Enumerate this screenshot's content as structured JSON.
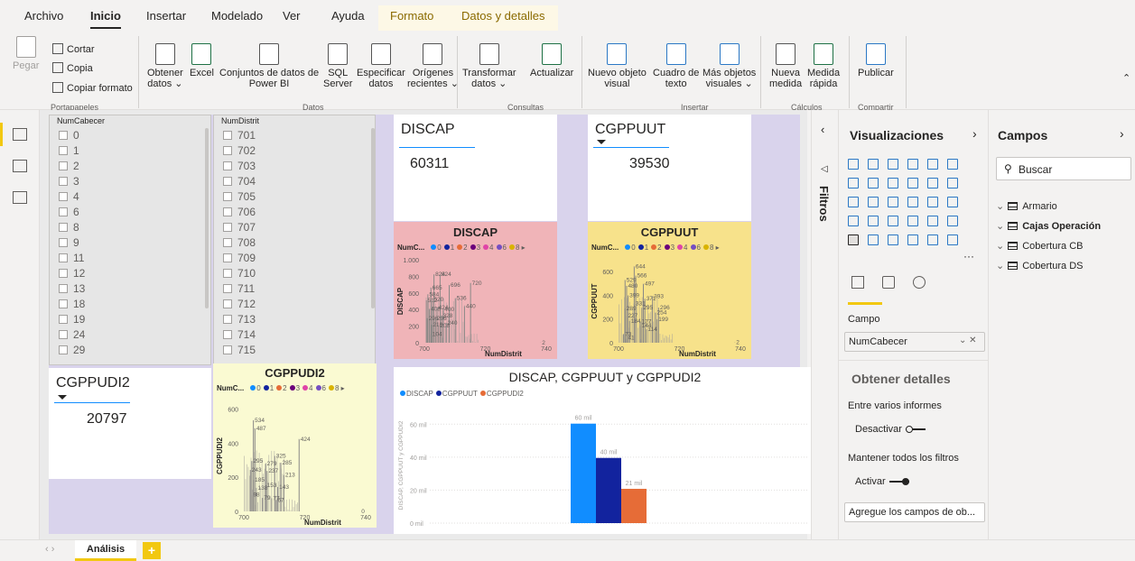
{
  "menu": {
    "tabs": [
      "Archivo",
      "Inicio",
      "Insertar",
      "Modelado",
      "Ver",
      "Ayuda",
      "Formato",
      "Datos y detalles"
    ],
    "active": "Inicio"
  },
  "ribbon": {
    "paste": "Pegar",
    "cut": "Cortar",
    "copy": "Copia",
    "copy_format": "Copiar formato",
    "g_clipboard": "Portapapeles",
    "get_data": "Obtener\ndatos ⌄",
    "excel": "Excel",
    "datasets": "Conjuntos de datos de\nPower BI",
    "sql": "SQL\nServer",
    "enter_data": "Especificar\ndatos",
    "recent": "Orígenes\nrecientes ⌄",
    "g_data": "Datos",
    "transform": "Transformar\ndatos ⌄",
    "refresh": "Actualizar",
    "g_queries": "Consultas",
    "new_visual": "Nuevo objeto\nvisual",
    "textbox": "Cuadro de\ntexto",
    "more_visuals": "Más objetos\nvisuales ⌄",
    "g_insert": "Insertar",
    "new_measure": "Nueva\nmedida",
    "quick_measure": "Medida\nrápida",
    "g_calc": "Cálculos",
    "publish": "Publicar",
    "g_share": "Compartir"
  },
  "slicer1": {
    "title": "NumCabecer",
    "items": [
      "0",
      "1",
      "2",
      "3",
      "4",
      "6",
      "8",
      "9",
      "11",
      "12",
      "13",
      "18",
      "19",
      "24",
      "29"
    ]
  },
  "slicer2": {
    "title": "NumDistrit",
    "items": [
      "701",
      "702",
      "703",
      "704",
      "705",
      "706",
      "707",
      "708",
      "709",
      "710",
      "711",
      "712",
      "713",
      "714",
      "715"
    ]
  },
  "cards": [
    {
      "title": "DISCAP",
      "value": "60311"
    },
    {
      "title": "CGPPUUT",
      "value": "39530"
    },
    {
      "title": "CGPPUDI2",
      "value": "20797"
    }
  ],
  "colors": {
    "discap": "#118dff",
    "cgppuut": "#12239e",
    "cgppudi2": "#e66c37",
    "pink": "#f0b4b8",
    "yellow": "#f7e28b",
    "lightyellow": "#fafad2",
    "accent": "#f2c811"
  },
  "legend": {
    "field": "NumC...",
    "entries": [
      "0",
      "1",
      "2",
      "3",
      "4",
      "6",
      "8"
    ],
    "colors": [
      "#118dff",
      "#12239e",
      "#e66c37",
      "#6b007b",
      "#e044a7",
      "#744ec2",
      "#d9b300"
    ]
  },
  "chart_data": [
    {
      "type": "bar",
      "title": "DISCAP",
      "xlabel": "NumDistrit",
      "ylabel": "DISCAP",
      "ylim": [
        0,
        1000
      ],
      "xlim": [
        700,
        740
      ],
      "yticks": [
        "0",
        "200",
        "400",
        "600",
        "800",
        "1.000"
      ],
      "xticks": [
        "700",
        "720",
        "740"
      ],
      "labels": [
        "824",
        "824",
        "696",
        "720",
        "665",
        "584",
        "536",
        "440",
        "512",
        "520",
        "408",
        "424",
        "400",
        "296",
        "296",
        "328",
        "216",
        "208",
        "240",
        "104",
        "2"
      ],
      "x": [
        703,
        705,
        708,
        715,
        702,
        701,
        710,
        713,
        700.5,
        702.5,
        701.5,
        704,
        706,
        700.8,
        703.5,
        705.5,
        702.2,
        704.5,
        707,
        702,
        738
      ],
      "values": [
        824,
        824,
        696,
        720,
        665,
        584,
        536,
        440,
        512,
        520,
        408,
        424,
        400,
        296,
        296,
        328,
        216,
        208,
        240,
        104,
        2
      ]
    },
    {
      "type": "bar",
      "title": "CGPPUUT",
      "xlabel": "NumDistrit",
      "ylabel": "CGPPUUT",
      "ylim": [
        0,
        700
      ],
      "xlim": [
        700,
        740
      ],
      "yticks": [
        "0",
        "200",
        "400",
        "600"
      ],
      "xticks": [
        "700",
        "720",
        "740"
      ],
      "labels": [
        "644",
        "566",
        "529",
        "480",
        "497",
        "399",
        "371",
        "393",
        "331",
        "295",
        "296",
        "289",
        "254",
        "199",
        "227",
        "177",
        "184",
        "144",
        "114",
        "73",
        "41",
        "2"
      ],
      "x": [
        705,
        705.5,
        702,
        702.5,
        708,
        703,
        708.5,
        711,
        705,
        707.5,
        713,
        702,
        712,
        712.5,
        702.5,
        707,
        703.5,
        707,
        709,
        701.5,
        702.5,
        738
      ],
      "values": [
        644,
        566,
        529,
        480,
        497,
        399,
        371,
        393,
        331,
        295,
        296,
        289,
        254,
        199,
        227,
        177,
        184,
        144,
        114,
        73,
        41,
        2
      ]
    },
    {
      "type": "bar",
      "title": "CGPPUDI2",
      "xlabel": "NumDistrit",
      "ylabel": "CGPPUDI2",
      "ylim": [
        0,
        650
      ],
      "xlim": [
        700,
        740
      ],
      "yticks": [
        "0",
        "200",
        "400",
        "600"
      ],
      "xticks": [
        "700",
        "720",
        "740"
      ],
      "labels": [
        "534",
        "487",
        "424",
        "325",
        "295",
        "279",
        "285",
        "243",
        "237",
        "213",
        "185",
        "153",
        "143",
        "138",
        "98",
        "79",
        "77",
        "67",
        "0"
      ],
      "x": [
        703,
        703.5,
        718,
        710,
        702.5,
        707,
        712,
        702,
        707.5,
        713,
        703,
        707,
        711,
        704,
        702.5,
        706,
        709,
        710.5,
        738
      ],
      "values": [
        534,
        487,
        424,
        325,
        295,
        279,
        285,
        243,
        237,
        213,
        185,
        153,
        143,
        138,
        98,
        79,
        77,
        67,
        0
      ]
    },
    {
      "type": "bar",
      "title": "DISCAP, CGPPUUT y CGPPUDI2",
      "ylabel": "DISCAP, CGPPUUT y CGPPUDI2",
      "ylim": [
        0,
        70
      ],
      "yticks": [
        "0 mil",
        "20 mil",
        "40 mil",
        "60 mil"
      ],
      "series": [
        {
          "name": "DISCAP",
          "values": [
            60311
          ],
          "label": "60 mil"
        },
        {
          "name": "CGPPUUT",
          "values": [
            39530
          ],
          "label": "40 mil"
        },
        {
          "name": "CGPPUDI2",
          "values": [
            20797
          ],
          "label": "21 mil"
        }
      ]
    }
  ],
  "filters": {
    "label": "Filtros"
  },
  "viz": {
    "title": "Visualizaciones",
    "campo": "Campo",
    "field_value": "NumCabecer",
    "details": "Obtener detalles",
    "cross_report": "Entre varios informes",
    "off": "Desactivar",
    "keep_filters": "Mantener todos los filtros",
    "on": "Activar",
    "add_fields": "Agregue los campos de ob...",
    "more": "···"
  },
  "fields": {
    "title": "Campos",
    "search": "Buscar",
    "tables": [
      "Armario",
      "Cajas Operación",
      "Cobertura CB",
      "Cobertura DS"
    ]
  },
  "bottom": {
    "page_tab": "Análisis",
    "add": "+"
  }
}
